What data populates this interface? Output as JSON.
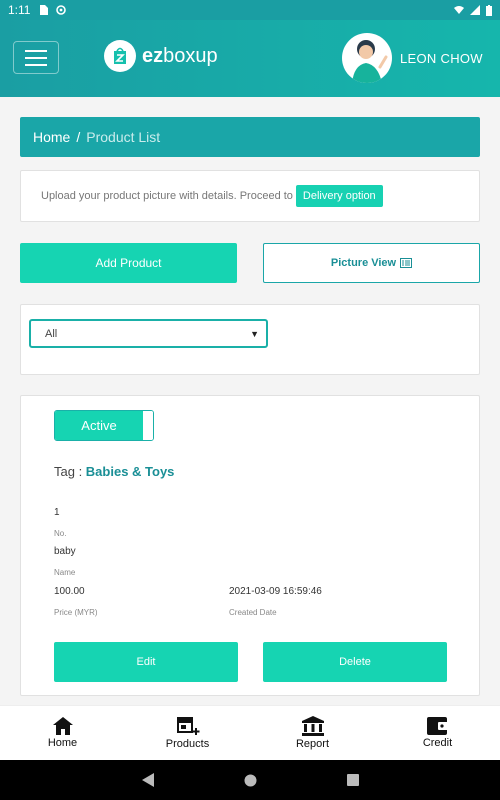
{
  "status_bar": {
    "time": "1:11",
    "icons": [
      "sd-card-icon",
      "sync-icon",
      "wifi-icon",
      "signal-icon",
      "battery-icon"
    ]
  },
  "header": {
    "logo_prefix": "ez",
    "logo_suffix": "boxup",
    "username": "LEON CHOW",
    "brand_color": "#1a9ea3"
  },
  "breadcrumb": {
    "home": "Home",
    "separator": "/",
    "current": "Product List"
  },
  "info": {
    "text": "Upload your product picture with details. Proceed to",
    "button": "Delivery option"
  },
  "actions": {
    "add_product": "Add Product",
    "picture_view": "Picture View"
  },
  "filter": {
    "selected": "All"
  },
  "product": {
    "status": "Active",
    "tag_label": "Tag : ",
    "tag_value": "Babies & Toys",
    "no_value": "1",
    "no_label": "No.",
    "name_value": "baby",
    "name_label": "Name",
    "price_value": "100.00",
    "price_label": "Price (MYR)",
    "date_value": "2021-03-09 16:59:46",
    "date_label": "Created Date",
    "edit": "Edit",
    "delete": "Delete"
  },
  "bottom_nav": {
    "home": "Home",
    "products": "Products",
    "report": "Report",
    "credit": "Credit"
  },
  "colors": {
    "accent": "#16d4b2",
    "teal": "#1aa6a8"
  }
}
